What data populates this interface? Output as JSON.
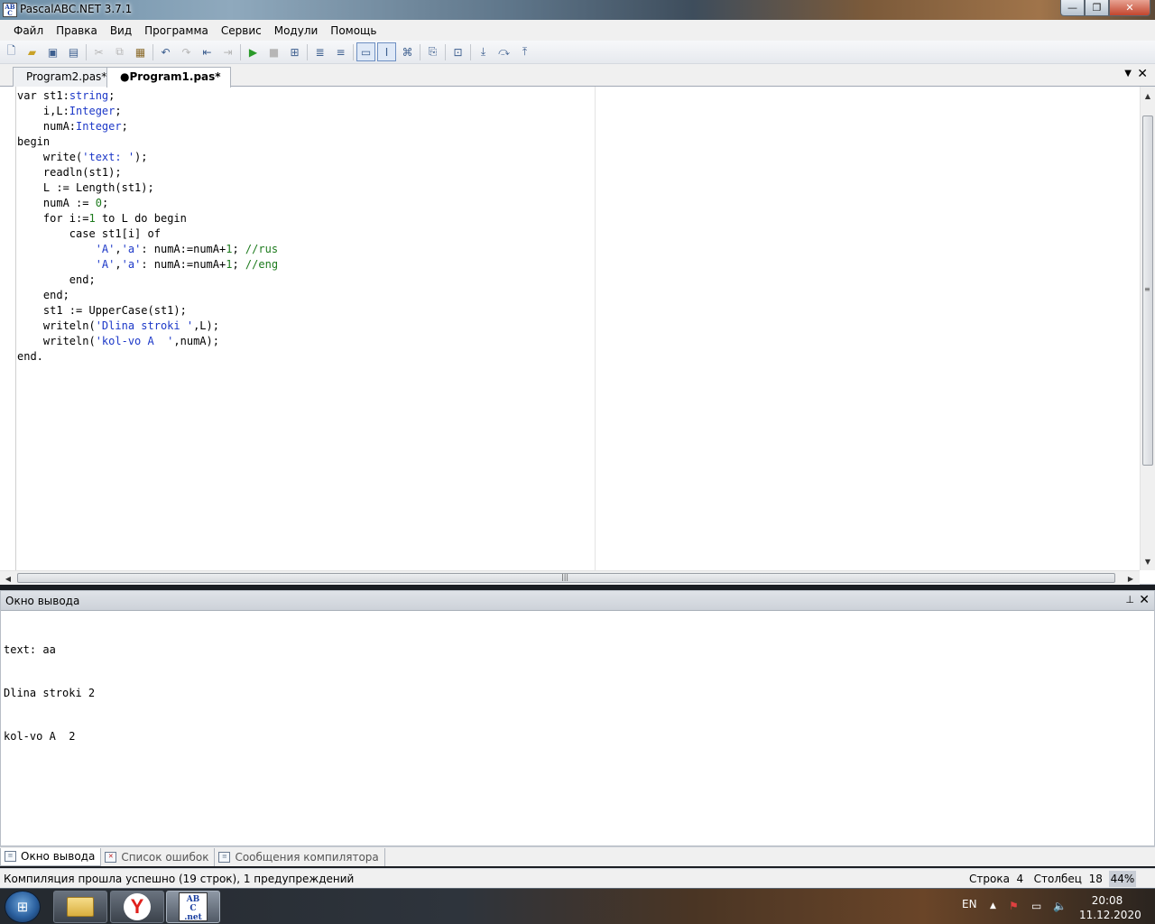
{
  "window": {
    "title": "PascalABC.NET 3.7.1",
    "app_icon_text": "AB\nC\n.net",
    "minimize": "—",
    "maximize": "❐",
    "close": "✕"
  },
  "menu": [
    "Файл",
    "Правка",
    "Вид",
    "Программа",
    "Сервис",
    "Модули",
    "Помощь"
  ],
  "tabs": [
    {
      "label": "Program2.pas*",
      "active": false
    },
    {
      "label": "●Program1.pas*",
      "active": true
    }
  ],
  "tab_controls": {
    "dropdown": "▼",
    "close": "✕"
  },
  "code_lines": [
    [
      {
        "t": "var ",
        "c": "kw"
      },
      {
        "t": "st1:",
        "c": ""
      },
      {
        "t": "string",
        "c": "ty"
      },
      {
        "t": ";",
        "c": ""
      }
    ],
    [
      {
        "t": "    i,L:",
        "c": ""
      },
      {
        "t": "Integer",
        "c": "ty"
      },
      {
        "t": ";",
        "c": ""
      }
    ],
    [
      {
        "t": "    numA:",
        "c": ""
      },
      {
        "t": "Integer",
        "c": "ty"
      },
      {
        "t": ";",
        "c": ""
      }
    ],
    [
      {
        "t": "begin",
        "c": "kw"
      }
    ],
    [
      {
        "t": "    write(",
        "c": ""
      },
      {
        "t": "'text: '",
        "c": "st"
      },
      {
        "t": ");",
        "c": ""
      }
    ],
    [
      {
        "t": "    readln(st1);",
        "c": ""
      }
    ],
    [
      {
        "t": "    L := Length(st1);",
        "c": ""
      }
    ],
    [
      {
        "t": "    numA := ",
        "c": ""
      },
      {
        "t": "0",
        "c": "nu"
      },
      {
        "t": ";",
        "c": ""
      }
    ],
    [
      {
        "t": "    for ",
        "c": "kw"
      },
      {
        "t": "i:=",
        "c": ""
      },
      {
        "t": "1",
        "c": "nu"
      },
      {
        "t": " to L do begin",
        "c": "kw"
      }
    ],
    [
      {
        "t": "        case ",
        "c": "kw"
      },
      {
        "t": "st1[i] ",
        "c": ""
      },
      {
        "t": "of",
        "c": "kw"
      }
    ],
    [
      {
        "t": "            ",
        "c": ""
      },
      {
        "t": "'А'",
        "c": "st"
      },
      {
        "t": ",",
        "c": ""
      },
      {
        "t": "'а'",
        "c": "st"
      },
      {
        "t": ": numA:=numA+",
        "c": ""
      },
      {
        "t": "1",
        "c": "nu"
      },
      {
        "t": "; ",
        "c": ""
      },
      {
        "t": "//rus",
        "c": "cm"
      }
    ],
    [
      {
        "t": "            ",
        "c": ""
      },
      {
        "t": "'A'",
        "c": "st"
      },
      {
        "t": ",",
        "c": ""
      },
      {
        "t": "'a'",
        "c": "st"
      },
      {
        "t": ": numA:=numA+",
        "c": ""
      },
      {
        "t": "1",
        "c": "nu"
      },
      {
        "t": "; ",
        "c": ""
      },
      {
        "t": "//eng",
        "c": "cm"
      }
    ],
    [
      {
        "t": "        end;",
        "c": "kw"
      }
    ],
    [
      {
        "t": "    end;",
        "c": "kw"
      }
    ],
    [
      {
        "t": "    st1 := UpperCase(st1);",
        "c": ""
      }
    ],
    [
      {
        "t": "    writeln(",
        "c": ""
      },
      {
        "t": "'Dlina stroki '",
        "c": "st"
      },
      {
        "t": ",L);",
        "c": ""
      }
    ],
    [
      {
        "t": "    writeln(",
        "c": ""
      },
      {
        "t": "'kol-vo A  '",
        "c": "st"
      },
      {
        "t": ",numA);",
        "c": ""
      }
    ],
    [
      {
        "t": "end.",
        "c": "kw"
      }
    ]
  ],
  "output_panel": {
    "title": "Окно вывода",
    "pin": "📌",
    "close": "✕",
    "lines": [
      "text: aa",
      "Dlina stroki 2",
      "kol-vo A  2"
    ]
  },
  "bottom_tabs": [
    {
      "label": "Окно вывода",
      "active": true
    },
    {
      "label": "Список ошибок",
      "active": false
    },
    {
      "label": "Сообщения компилятора",
      "active": false
    }
  ],
  "status": {
    "message": "Компиляция прошла успешно (19 строк), 1 предупреждений",
    "position": "Строка  4   Столбец  18",
    "zoom": "44%"
  },
  "taskbar": {
    "language": "EN",
    "time": "20:08",
    "date": "11.12.2020",
    "yandex_letter": "Y",
    "abc_text": "AB\nC\n.net"
  },
  "colors": {
    "keyword": "#000000",
    "type": "#1c38c8",
    "string": "#1c38c8",
    "number": "#1c7a1c",
    "comment": "#1c7a1c"
  }
}
